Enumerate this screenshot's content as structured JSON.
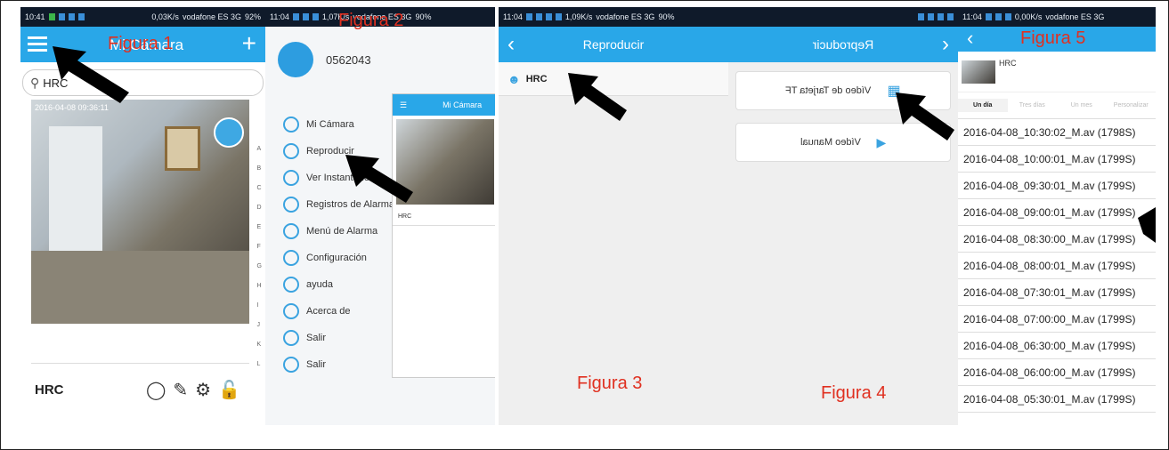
{
  "colors": {
    "accent": "#29a7e8",
    "figure_label": "#e03020"
  },
  "panel1": {
    "status": {
      "time": "10:41",
      "speed": "0,03K/s",
      "carrier": "vodafone ES 3G",
      "battery": "92%"
    },
    "title": "Mi Cámara",
    "figure": "Figura 1",
    "search_value": "HRC",
    "video_timestamp": "2016-04-08 09:36:11",
    "camera_name": "HRC",
    "alpha_index": [
      "A",
      "B",
      "C",
      "D",
      "E",
      "F",
      "G",
      "H",
      "I",
      "J",
      "K",
      "L"
    ]
  },
  "panel2": {
    "status": {
      "time": "11:04",
      "speed": "1,07K/s",
      "carrier": "vodafone ES 3G",
      "battery": "90%"
    },
    "figure": "Figura 2",
    "device_id": "0562043",
    "menu": [
      "Mi Cámara",
      "Reproducir",
      "Ver Instantánea",
      "Registros de Alarma",
      "Menú de Alarma",
      "Configuración",
      "ayuda",
      "Acerca de",
      "Salir",
      "Salir"
    ],
    "preview_title": "Mi Cámara",
    "preview_cam": "HRC"
  },
  "panel3": {
    "status": {
      "time": "11:04",
      "speed": "1,09K/s",
      "carrier": "vodafone ES 3G",
      "battery": "90%"
    },
    "title": "Reproducir",
    "item": "HRC",
    "figure": "Figura 3"
  },
  "panel4": {
    "title": "Reproducir",
    "options": [
      "Vídeo de Tarjeta TF",
      "Vídeo Manual"
    ],
    "figure": "Figura 4"
  },
  "panel5": {
    "status": {
      "time": "11:04",
      "speed": "0,00K/s",
      "carrier": "vodafone ES 3G"
    },
    "figure": "Figura 5",
    "camera": "HRC",
    "tabs": [
      "Un día",
      "Tres días",
      "Un mes",
      "Personalizar"
    ],
    "recordings": [
      "2016-04-08_10:30:02_M.av (1798S)",
      "2016-04-08_10:00:01_M.av (1799S)",
      "2016-04-08_09:30:01_M.av (1799S)",
      "2016-04-08_09:00:01_M.av (1799S)",
      "2016-04-08_08:30:00_M.av (1799S)",
      "2016-04-08_08:00:01_M.av (1799S)",
      "2016-04-08_07:30:01_M.av (1799S)",
      "2016-04-08_07:00:00_M.av (1799S)",
      "2016-04-08_06:30:00_M.av (1799S)",
      "2016-04-08_06:00:00_M.av (1799S)",
      "2016-04-08_05:30:01_M.av (1799S)"
    ]
  }
}
